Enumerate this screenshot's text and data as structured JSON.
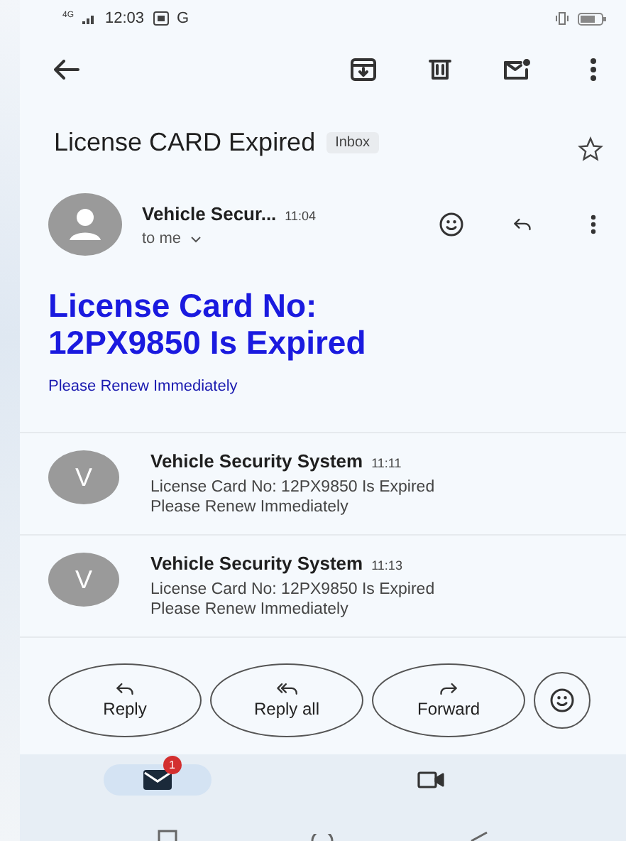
{
  "status_bar": {
    "network": "4G",
    "time": "12:03",
    "carrier": "G"
  },
  "subject": {
    "title": "License CARD Expired",
    "label": "Inbox",
    "starred": false
  },
  "open_message": {
    "sender": "Vehicle Secur...",
    "time": "11:04",
    "recipient": "to me",
    "heading": "License Card No: 12PX9850 Is Expired",
    "body": "Please Renew Immediately"
  },
  "thread": [
    {
      "initial": "V",
      "sender": "Vehicle Security System",
      "time": "11:11",
      "lines": [
        "License Card No: 12PX9850 Is Expired",
        "Please Renew Immediately"
      ]
    },
    {
      "initial": "V",
      "sender": "Vehicle Security System",
      "time": "11:13",
      "lines": [
        "License Card No: 12PX9850 Is Expired",
        "Please Renew Immediately"
      ]
    }
  ],
  "actions": [
    {
      "kind": "reply",
      "label": "Reply"
    },
    {
      "kind": "reply_all",
      "label": "Reply all"
    },
    {
      "kind": "forward",
      "label": "Forward"
    }
  ],
  "bottom_nav": [
    {
      "kind": "mail",
      "selected": true,
      "badge": "1"
    },
    {
      "kind": "video",
      "selected": false
    }
  ]
}
